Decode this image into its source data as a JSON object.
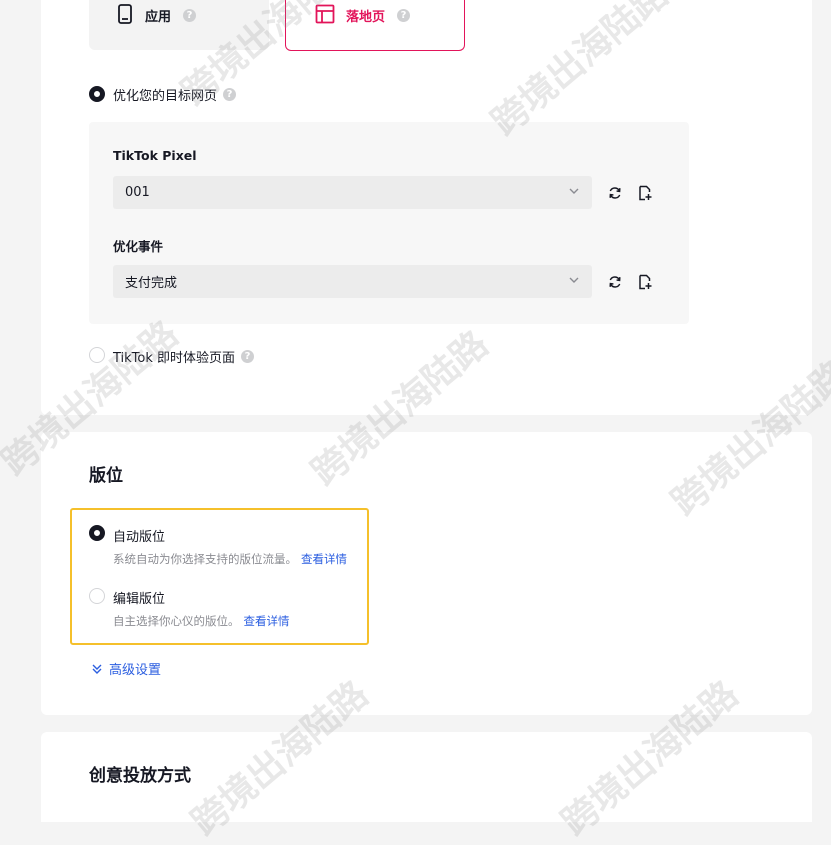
{
  "promotion_type": {
    "app_card": {
      "label": "应用",
      "icon": "mobile-device-icon",
      "help": "?"
    },
    "landing_card": {
      "label": "落地页",
      "icon": "layout-icon",
      "help": "?",
      "accent": "#e2145a"
    }
  },
  "optimization": {
    "website_option": {
      "label": "优化您的目标网页",
      "help": "?"
    },
    "pixel_label": "TikTok Pixel",
    "pixel_value": "001",
    "event_label": "优化事件",
    "event_value": "支付完成",
    "instant_page_option": {
      "label": "TikTok 即时体验页面",
      "help": "?"
    }
  },
  "placement": {
    "title": "版位",
    "auto": {
      "label": "自动版位",
      "desc": "系统自动为你选择支持的版位流量。",
      "link": "查看详情"
    },
    "edit": {
      "label": "编辑版位",
      "desc": "自主选择你心仪的版位。",
      "link": "查看详情"
    },
    "advanced": "高级设置",
    "highlight_color": "#f5c02b",
    "link_color": "#2b5ee0"
  },
  "creative": {
    "title": "创意投放方式"
  },
  "watermark": "跨境出海陆路"
}
